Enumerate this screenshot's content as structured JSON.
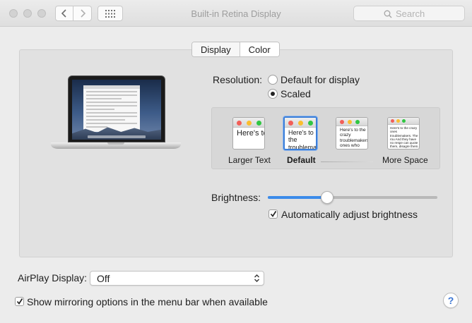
{
  "window": {
    "title": "Built-in Retina Display",
    "search_placeholder": "Search",
    "icons": {
      "back": "chevron-left-icon",
      "forward": "chevron-right-icon",
      "show_all": "grid-icon",
      "search": "magnifier-icon"
    }
  },
  "tabs": [
    {
      "label": "Display",
      "selected": true
    },
    {
      "label": "Color",
      "selected": false
    }
  ],
  "resolution": {
    "label": "Resolution:",
    "options": [
      {
        "label": "Default for display",
        "selected": false
      },
      {
        "label": "Scaled",
        "selected": true
      }
    ],
    "scaled_options": [
      {
        "caption": "Larger Text",
        "preview_text": "Here's to the troublemak",
        "selected": false
      },
      {
        "caption": "Default",
        "preview_text": "Here's to the troublemakers. ones who see t",
        "selected": true
      },
      {
        "caption": "",
        "preview_text": "Here's to the crazy troublemakers. ones who see the rules. And they",
        "selected": false
      },
      {
        "caption": "More Space",
        "preview_text": "Here's to the crazy ones troublemakers. The rou And they have no respe can quote them, disagre them. About the only thin Because they change thi",
        "selected": false
      }
    ]
  },
  "brightness": {
    "label": "Brightness:",
    "value": 0.35,
    "auto_label": "Automatically adjust brightness",
    "auto_checked": true
  },
  "airplay": {
    "label": "AirPlay Display:",
    "selected": "Off"
  },
  "mirroring": {
    "label": "Show mirroring options in the menu bar when available",
    "checked": true
  },
  "help_label": "?",
  "colors": {
    "accent": "#3b8bea",
    "close": "#f25f58",
    "minimize": "#fbbe2e",
    "zoom": "#30c642"
  }
}
